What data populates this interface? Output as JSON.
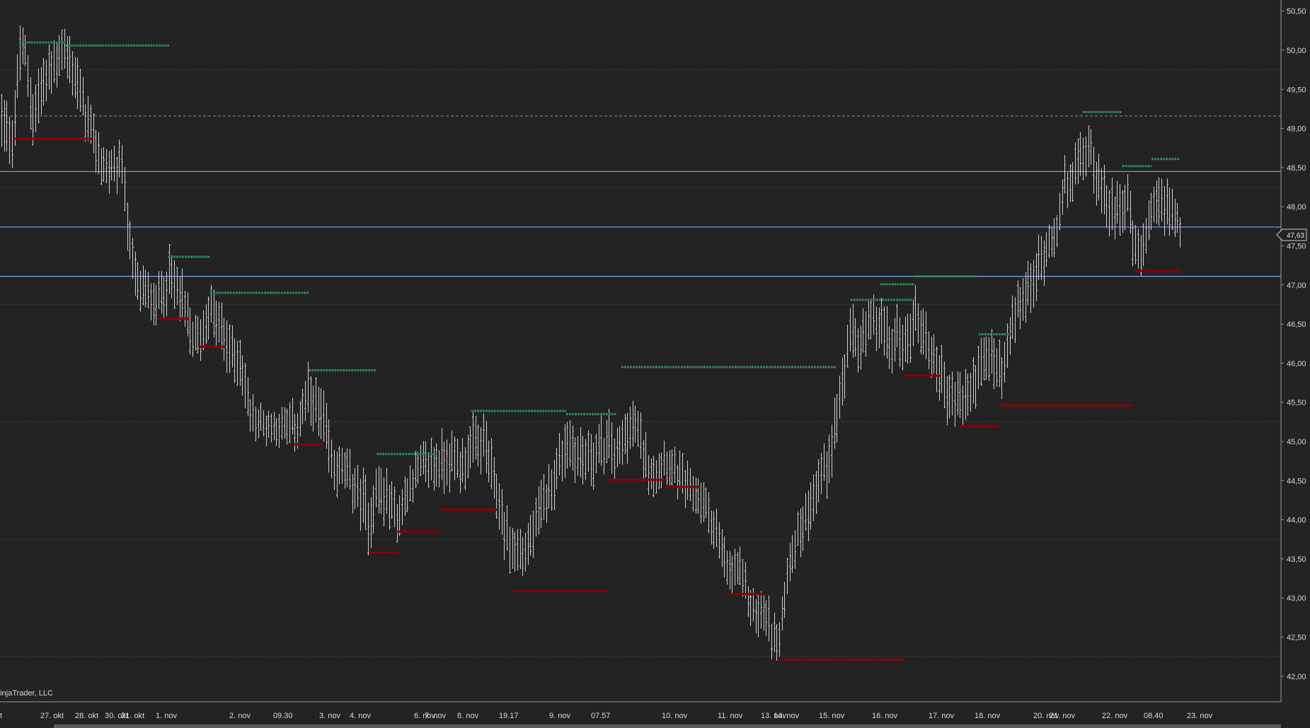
{
  "chart_data": {
    "type": "bar",
    "style": "ohlc",
    "watermark": "ninjaTrader, LLC",
    "ylim": [
      41.8,
      50.6
    ],
    "y_ticks": [
      "50,50",
      "50,00",
      "49,50",
      "49,00",
      "48,50",
      "48,00",
      "47,50",
      "47,00",
      "46,50",
      "46,00",
      "45,50",
      "45,00",
      "44,50",
      "44,00",
      "43,50",
      "43,00",
      "42,50",
      "42,00"
    ],
    "y_tick_values": [
      50.5,
      50.0,
      49.5,
      49.0,
      48.5,
      48.0,
      47.5,
      47.0,
      46.5,
      46.0,
      45.5,
      45.0,
      44.5,
      44.0,
      43.5,
      43.0,
      42.5,
      42.0
    ],
    "x_ticks": [
      "t",
      "27. okt",
      "28. okt",
      "30. okt",
      "31. okt",
      "1. nov",
      "2. nov",
      "09.30",
      "3. nov",
      "4. nov",
      "6. nov",
      "7. nov",
      "8. nov",
      "19.17",
      "9. nov",
      "07.57",
      "10. nov",
      "11. nov",
      "13. nov",
      "14. nov",
      "15. nov",
      "16. nov",
      "17. nov",
      "18. nov",
      "20. nov",
      "21. nov",
      "22. nov",
      "08.40",
      "23. nov"
    ],
    "current_price": "47,63",
    "current_price_value": 47.63,
    "dotted_grid_values": [
      49.75,
      48.25,
      46.75,
      45.25,
      43.75,
      42.25
    ],
    "dashed_level": 49.16,
    "horizontal_lines": [
      48.45,
      47.74,
      47.11
    ],
    "colors": {
      "background": "#232323",
      "bars": "#cfcfcf",
      "resistance": "#2e8b57",
      "support": "#8b0000",
      "blue_lines": "#7aa7e0",
      "grid": "#4a4a4a",
      "axis_text": "#d8d8d8"
    },
    "resistance_segments": [
      {
        "x0": 0.015,
        "x1": 0.051,
        "y": 50.1
      },
      {
        "x0": 0.051,
        "x1": 0.132,
        "y": 50.06
      },
      {
        "x0": 0.131,
        "x1": 0.164,
        "y": 47.36
      },
      {
        "x0": 0.164,
        "x1": 0.241,
        "y": 46.9
      },
      {
        "x0": 0.241,
        "x1": 0.294,
        "y": 45.91
      },
      {
        "x0": 0.294,
        "x1": 0.341,
        "y": 44.84
      },
      {
        "x0": 0.368,
        "x1": 0.442,
        "y": 45.39
      },
      {
        "x0": 0.442,
        "x1": 0.481,
        "y": 45.35
      },
      {
        "x0": 0.485,
        "x1": 0.653,
        "y": 45.95
      },
      {
        "x0": 0.664,
        "x1": 0.714,
        "y": 46.81
      },
      {
        "x0": 0.687,
        "x1": 0.714,
        "y": 47.01
      },
      {
        "x0": 0.714,
        "x1": 0.763,
        "y": 47.11
      },
      {
        "x0": 0.764,
        "x1": 0.789,
        "y": 46.37
      },
      {
        "x0": 0.845,
        "x1": 0.876,
        "y": 49.21
      },
      {
        "x0": 0.876,
        "x1": 0.899,
        "y": 48.52
      },
      {
        "x0": 0.899,
        "x1": 0.921,
        "y": 48.61
      }
    ],
    "support_segments": [
      {
        "x0": 0.01,
        "x1": 0.072,
        "y": 48.87
      },
      {
        "x0": 0.123,
        "x1": 0.148,
        "y": 46.57
      },
      {
        "x0": 0.155,
        "x1": 0.176,
        "y": 46.21
      },
      {
        "x0": 0.229,
        "x1": 0.253,
        "y": 44.96
      },
      {
        "x0": 0.288,
        "x1": 0.311,
        "y": 43.58
      },
      {
        "x0": 0.309,
        "x1": 0.343,
        "y": 43.85
      },
      {
        "x0": 0.344,
        "x1": 0.388,
        "y": 44.13
      },
      {
        "x0": 0.401,
        "x1": 0.475,
        "y": 43.09
      },
      {
        "x0": 0.475,
        "x1": 0.519,
        "y": 44.51
      },
      {
        "x0": 0.519,
        "x1": 0.546,
        "y": 44.42
      },
      {
        "x0": 0.569,
        "x1": 0.596,
        "y": 43.05
      },
      {
        "x0": 0.607,
        "x1": 0.706,
        "y": 42.21
      },
      {
        "x0": 0.706,
        "x1": 0.734,
        "y": 45.84
      },
      {
        "x0": 0.749,
        "x1": 0.78,
        "y": 45.2
      },
      {
        "x0": 0.78,
        "x1": 0.884,
        "y": 45.46
      },
      {
        "x0": 0.885,
        "x1": 0.921,
        "y": 47.18
      }
    ],
    "anchors": [
      [
        0.0,
        49.1,
        0.6
      ],
      [
        0.01,
        48.9,
        0.5
      ],
      [
        0.015,
        49.9,
        0.6
      ],
      [
        0.018,
        50.1,
        0.3
      ],
      [
        0.025,
        49.2,
        0.6
      ],
      [
        0.035,
        49.6,
        0.5
      ],
      [
        0.042,
        49.8,
        0.5
      ],
      [
        0.048,
        50.05,
        0.4
      ],
      [
        0.058,
        49.7,
        0.5
      ],
      [
        0.066,
        49.2,
        0.5
      ],
      [
        0.073,
        48.8,
        0.5
      ],
      [
        0.08,
        48.55,
        0.4
      ],
      [
        0.09,
        48.4,
        0.4
      ],
      [
        0.096,
        48.6,
        0.4
      ],
      [
        0.1,
        47.6,
        0.5
      ],
      [
        0.106,
        47.0,
        0.5
      ],
      [
        0.114,
        46.9,
        0.4
      ],
      [
        0.123,
        46.8,
        0.4
      ],
      [
        0.131,
        47.1,
        0.5
      ],
      [
        0.14,
        46.9,
        0.5
      ],
      [
        0.148,
        46.4,
        0.5
      ],
      [
        0.155,
        46.3,
        0.4
      ],
      [
        0.164,
        46.7,
        0.5
      ],
      [
        0.175,
        46.3,
        0.5
      ],
      [
        0.182,
        46.1,
        0.5
      ],
      [
        0.188,
        46.0,
        0.5
      ],
      [
        0.196,
        45.3,
        0.4
      ],
      [
        0.21,
        45.2,
        0.3
      ],
      [
        0.225,
        45.2,
        0.4
      ],
      [
        0.232,
        45.2,
        0.4
      ],
      [
        0.241,
        45.6,
        0.5
      ],
      [
        0.253,
        45.2,
        0.5
      ],
      [
        0.259,
        44.7,
        0.5
      ],
      [
        0.27,
        44.6,
        0.4
      ],
      [
        0.281,
        44.3,
        0.5
      ],
      [
        0.288,
        44.0,
        0.6
      ],
      [
        0.294,
        44.4,
        0.5
      ],
      [
        0.305,
        44.2,
        0.5
      ],
      [
        0.311,
        44.0,
        0.4
      ],
      [
        0.32,
        44.5,
        0.4
      ],
      [
        0.33,
        44.7,
        0.4
      ],
      [
        0.341,
        44.7,
        0.5
      ],
      [
        0.35,
        44.8,
        0.5
      ],
      [
        0.36,
        44.7,
        0.5
      ],
      [
        0.368,
        44.9,
        0.5
      ],
      [
        0.378,
        45.0,
        0.5
      ],
      [
        0.383,
        44.6,
        0.5
      ],
      [
        0.388,
        44.3,
        0.5
      ],
      [
        0.395,
        43.8,
        0.5
      ],
      [
        0.401,
        43.6,
        0.5
      ],
      [
        0.41,
        43.6,
        0.4
      ],
      [
        0.418,
        43.9,
        0.5
      ],
      [
        0.426,
        44.3,
        0.5
      ],
      [
        0.436,
        44.7,
        0.5
      ],
      [
        0.442,
        45.0,
        0.5
      ],
      [
        0.452,
        44.8,
        0.5
      ],
      [
        0.46,
        44.8,
        0.5
      ],
      [
        0.47,
        44.9,
        0.5
      ],
      [
        0.475,
        45.0,
        0.5
      ],
      [
        0.481,
        44.8,
        0.5
      ],
      [
        0.49,
        45.2,
        0.5
      ],
      [
        0.496,
        45.2,
        0.4
      ],
      [
        0.503,
        44.8,
        0.5
      ],
      [
        0.51,
        44.6,
        0.4
      ],
      [
        0.519,
        44.8,
        0.4
      ],
      [
        0.528,
        44.6,
        0.4
      ],
      [
        0.537,
        44.4,
        0.4
      ],
      [
        0.546,
        44.3,
        0.4
      ],
      [
        0.553,
        44.1,
        0.4
      ],
      [
        0.56,
        43.8,
        0.4
      ],
      [
        0.566,
        43.4,
        0.4
      ],
      [
        0.569,
        43.3,
        0.4
      ],
      [
        0.576,
        43.4,
        0.4
      ],
      [
        0.584,
        43.0,
        0.4
      ],
      [
        0.59,
        42.8,
        0.4
      ],
      [
        0.596,
        42.8,
        0.4
      ],
      [
        0.604,
        42.5,
        0.5
      ],
      [
        0.608,
        42.4,
        0.4
      ],
      [
        0.614,
        43.3,
        0.4
      ],
      [
        0.62,
        43.7,
        0.4
      ],
      [
        0.628,
        44.0,
        0.5
      ],
      [
        0.636,
        44.4,
        0.5
      ],
      [
        0.645,
        44.7,
        0.5
      ],
      [
        0.653,
        45.3,
        0.5
      ],
      [
        0.66,
        46.0,
        0.5
      ],
      [
        0.665,
        46.4,
        0.5
      ],
      [
        0.672,
        46.2,
        0.5
      ],
      [
        0.68,
        46.5,
        0.5
      ],
      [
        0.687,
        46.5,
        0.5
      ],
      [
        0.694,
        46.2,
        0.5
      ],
      [
        0.702,
        46.4,
        0.5
      ],
      [
        0.708,
        46.2,
        0.5
      ],
      [
        0.714,
        46.7,
        0.5
      ],
      [
        0.722,
        46.3,
        0.5
      ],
      [
        0.731,
        46.0,
        0.5
      ],
      [
        0.74,
        45.6,
        0.5
      ],
      [
        0.748,
        45.5,
        0.5
      ],
      [
        0.756,
        45.6,
        0.5
      ],
      [
        0.764,
        45.9,
        0.5
      ],
      [
        0.774,
        46.1,
        0.5
      ],
      [
        0.782,
        45.8,
        0.5
      ],
      [
        0.789,
        46.4,
        0.5
      ],
      [
        0.796,
        46.8,
        0.5
      ],
      [
        0.804,
        46.9,
        0.5
      ],
      [
        0.812,
        47.3,
        0.5
      ],
      [
        0.82,
        47.6,
        0.4
      ],
      [
        0.826,
        47.8,
        0.4
      ],
      [
        0.831,
        48.3,
        0.4
      ],
      [
        0.838,
        48.4,
        0.4
      ],
      [
        0.845,
        48.7,
        0.5
      ],
      [
        0.851,
        48.8,
        0.5
      ],
      [
        0.857,
        48.3,
        0.5
      ],
      [
        0.864,
        48.0,
        0.5
      ],
      [
        0.872,
        48.0,
        0.5
      ],
      [
        0.88,
        48.1,
        0.5
      ],
      [
        0.886,
        47.4,
        0.5
      ],
      [
        0.89,
        47.4,
        0.4
      ],
      [
        0.896,
        47.7,
        0.4
      ],
      [
        0.902,
        48.0,
        0.5
      ],
      [
        0.908,
        48.0,
        0.5
      ],
      [
        0.914,
        48.0,
        0.5
      ],
      [
        0.918,
        47.9,
        0.4
      ],
      [
        0.921,
        47.63,
        0.3
      ]
    ]
  }
}
